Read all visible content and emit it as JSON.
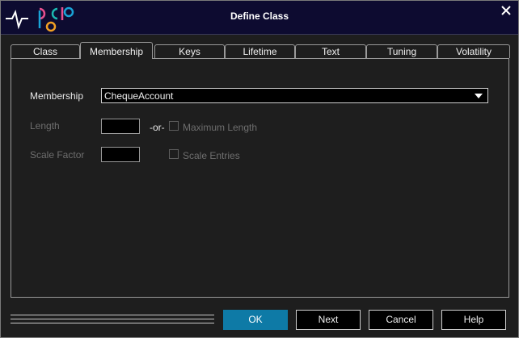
{
  "window": {
    "title": "Define Class"
  },
  "tabs": [
    {
      "label": "Class"
    },
    {
      "label": "Membership",
      "active": true
    },
    {
      "label": "Keys"
    },
    {
      "label": "Lifetime"
    },
    {
      "label": "Text"
    },
    {
      "label": "Tuning"
    },
    {
      "label": "Volatility"
    }
  ],
  "membership": {
    "label": "Membership",
    "value": "ChequeAccount"
  },
  "length": {
    "label": "Length",
    "value": "",
    "or_text": "-or-",
    "max_length_label": "Maximum Length",
    "max_length_checked": false
  },
  "scale": {
    "label": "Scale Factor",
    "value": "",
    "entries_label": "Scale Entries",
    "entries_checked": false
  },
  "buttons": {
    "ok": "OK",
    "next": "Next",
    "cancel": "Cancel",
    "help": "Help"
  },
  "colors": {
    "titlebar": "#0d0b30",
    "accent": "#0e7aa6",
    "background": "#1e1e1e",
    "disabled_text": "#6e6e6e"
  },
  "icons": {
    "logo": "app-logo",
    "close": "close-icon",
    "dropdown": "chevron-down-icon"
  }
}
